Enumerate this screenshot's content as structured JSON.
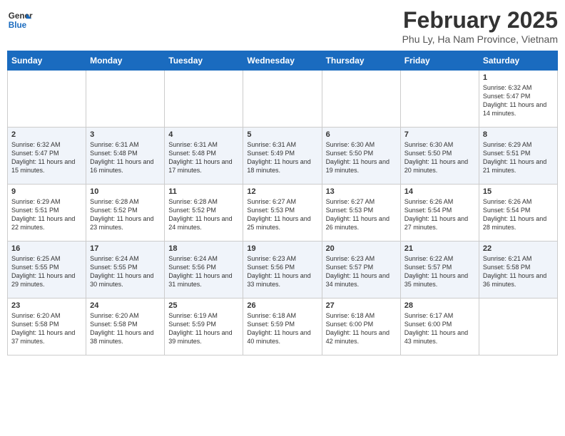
{
  "header": {
    "logo_line1": "General",
    "logo_line2": "Blue",
    "month": "February 2025",
    "location": "Phu Ly, Ha Nam Province, Vietnam"
  },
  "weekdays": [
    "Sunday",
    "Monday",
    "Tuesday",
    "Wednesday",
    "Thursday",
    "Friday",
    "Saturday"
  ],
  "weeks": [
    [
      {
        "day": "",
        "info": ""
      },
      {
        "day": "",
        "info": ""
      },
      {
        "day": "",
        "info": ""
      },
      {
        "day": "",
        "info": ""
      },
      {
        "day": "",
        "info": ""
      },
      {
        "day": "",
        "info": ""
      },
      {
        "day": "1",
        "info": "Sunrise: 6:32 AM\nSunset: 5:47 PM\nDaylight: 11 hours\nand 14 minutes."
      }
    ],
    [
      {
        "day": "2",
        "info": "Sunrise: 6:32 AM\nSunset: 5:47 PM\nDaylight: 11 hours\nand 15 minutes."
      },
      {
        "day": "3",
        "info": "Sunrise: 6:31 AM\nSunset: 5:48 PM\nDaylight: 11 hours\nand 16 minutes."
      },
      {
        "day": "4",
        "info": "Sunrise: 6:31 AM\nSunset: 5:48 PM\nDaylight: 11 hours\nand 17 minutes."
      },
      {
        "day": "5",
        "info": "Sunrise: 6:31 AM\nSunset: 5:49 PM\nDaylight: 11 hours\nand 18 minutes."
      },
      {
        "day": "6",
        "info": "Sunrise: 6:30 AM\nSunset: 5:50 PM\nDaylight: 11 hours\nand 19 minutes."
      },
      {
        "day": "7",
        "info": "Sunrise: 6:30 AM\nSunset: 5:50 PM\nDaylight: 11 hours\nand 20 minutes."
      },
      {
        "day": "8",
        "info": "Sunrise: 6:29 AM\nSunset: 5:51 PM\nDaylight: 11 hours\nand 21 minutes."
      }
    ],
    [
      {
        "day": "9",
        "info": "Sunrise: 6:29 AM\nSunset: 5:51 PM\nDaylight: 11 hours\nand 22 minutes."
      },
      {
        "day": "10",
        "info": "Sunrise: 6:28 AM\nSunset: 5:52 PM\nDaylight: 11 hours\nand 23 minutes."
      },
      {
        "day": "11",
        "info": "Sunrise: 6:28 AM\nSunset: 5:52 PM\nDaylight: 11 hours\nand 24 minutes."
      },
      {
        "day": "12",
        "info": "Sunrise: 6:27 AM\nSunset: 5:53 PM\nDaylight: 11 hours\nand 25 minutes."
      },
      {
        "day": "13",
        "info": "Sunrise: 6:27 AM\nSunset: 5:53 PM\nDaylight: 11 hours\nand 26 minutes."
      },
      {
        "day": "14",
        "info": "Sunrise: 6:26 AM\nSunset: 5:54 PM\nDaylight: 11 hours\nand 27 minutes."
      },
      {
        "day": "15",
        "info": "Sunrise: 6:26 AM\nSunset: 5:54 PM\nDaylight: 11 hours\nand 28 minutes."
      }
    ],
    [
      {
        "day": "16",
        "info": "Sunrise: 6:25 AM\nSunset: 5:55 PM\nDaylight: 11 hours\nand 29 minutes."
      },
      {
        "day": "17",
        "info": "Sunrise: 6:24 AM\nSunset: 5:55 PM\nDaylight: 11 hours\nand 30 minutes."
      },
      {
        "day": "18",
        "info": "Sunrise: 6:24 AM\nSunset: 5:56 PM\nDaylight: 11 hours\nand 31 minutes."
      },
      {
        "day": "19",
        "info": "Sunrise: 6:23 AM\nSunset: 5:56 PM\nDaylight: 11 hours\nand 33 minutes."
      },
      {
        "day": "20",
        "info": "Sunrise: 6:23 AM\nSunset: 5:57 PM\nDaylight: 11 hours\nand 34 minutes."
      },
      {
        "day": "21",
        "info": "Sunrise: 6:22 AM\nSunset: 5:57 PM\nDaylight: 11 hours\nand 35 minutes."
      },
      {
        "day": "22",
        "info": "Sunrise: 6:21 AM\nSunset: 5:58 PM\nDaylight: 11 hours\nand 36 minutes."
      }
    ],
    [
      {
        "day": "23",
        "info": "Sunrise: 6:20 AM\nSunset: 5:58 PM\nDaylight: 11 hours\nand 37 minutes."
      },
      {
        "day": "24",
        "info": "Sunrise: 6:20 AM\nSunset: 5:58 PM\nDaylight: 11 hours\nand 38 minutes."
      },
      {
        "day": "25",
        "info": "Sunrise: 6:19 AM\nSunset: 5:59 PM\nDaylight: 11 hours\nand 39 minutes."
      },
      {
        "day": "26",
        "info": "Sunrise: 6:18 AM\nSunset: 5:59 PM\nDaylight: 11 hours\nand 40 minutes."
      },
      {
        "day": "27",
        "info": "Sunrise: 6:18 AM\nSunset: 6:00 PM\nDaylight: 11 hours\nand 42 minutes."
      },
      {
        "day": "28",
        "info": "Sunrise: 6:17 AM\nSunset: 6:00 PM\nDaylight: 11 hours\nand 43 minutes."
      },
      {
        "day": "",
        "info": ""
      }
    ]
  ]
}
